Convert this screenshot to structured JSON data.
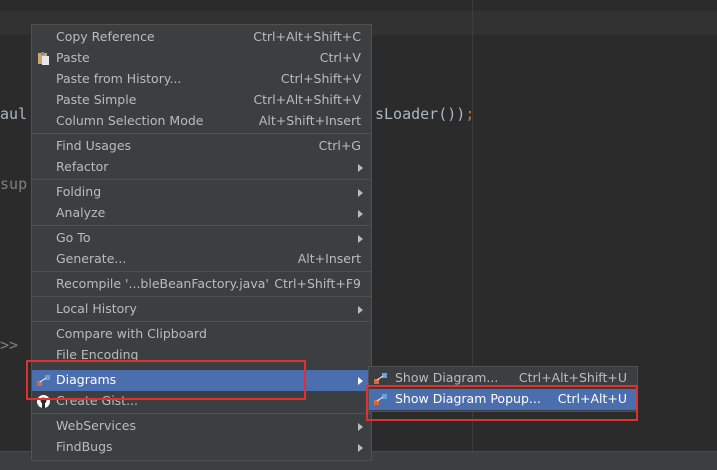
{
  "editor": {
    "code_fragment_1": "aul",
    "code_fragment_2": "sLoader())",
    "code_semicolon": ";",
    "code_fragment_3": " sup",
    "code_fragment_4": "r>>"
  },
  "context_menu": {
    "items": [
      {
        "label": "Copy Reference",
        "shortcut": "Ctrl+Alt+Shift+C"
      },
      {
        "label": "Paste",
        "shortcut": "Ctrl+V",
        "icon": "paste-icon"
      },
      {
        "label": "Paste from History...",
        "shortcut": "Ctrl+Shift+V"
      },
      {
        "label": "Paste Simple",
        "shortcut": "Ctrl+Alt+Shift+V"
      },
      {
        "label": "Column Selection Mode",
        "shortcut": "Alt+Shift+Insert"
      },
      {
        "label": "Find Usages",
        "shortcut": "Ctrl+G"
      },
      {
        "label": "Refactor",
        "submenu": true
      },
      {
        "label": "Folding",
        "submenu": true
      },
      {
        "label": "Analyze",
        "submenu": true
      },
      {
        "label": "Go To",
        "submenu": true
      },
      {
        "label": "Generate...",
        "shortcut": "Alt+Insert"
      },
      {
        "label": "Recompile '...bleBeanFactory.java'",
        "shortcut": "Ctrl+Shift+F9"
      },
      {
        "label": "Local History",
        "submenu": true
      },
      {
        "label": "Compare with Clipboard"
      },
      {
        "label": "File Encoding"
      },
      {
        "label": "Diagrams",
        "submenu": true,
        "selected": true,
        "icon": "diagram-icon"
      },
      {
        "label": "Create Gist...",
        "icon": "github-icon"
      },
      {
        "label": "WebServices",
        "submenu": true
      },
      {
        "label": "FindBugs",
        "submenu": true
      }
    ]
  },
  "diagrams_submenu": {
    "items": [
      {
        "label": "Show Diagram...",
        "shortcut": "Ctrl+Alt+Shift+U",
        "icon": "diagram-icon"
      },
      {
        "label": "Show Diagram Popup...",
        "shortcut": "Ctrl+Alt+U",
        "icon": "diagram-icon",
        "selected": true
      }
    ]
  },
  "colors": {
    "background": "#2b2b2b",
    "menu_background": "#3c3f41",
    "selection": "#4b6eaf",
    "highlight_box": "#e03030"
  }
}
